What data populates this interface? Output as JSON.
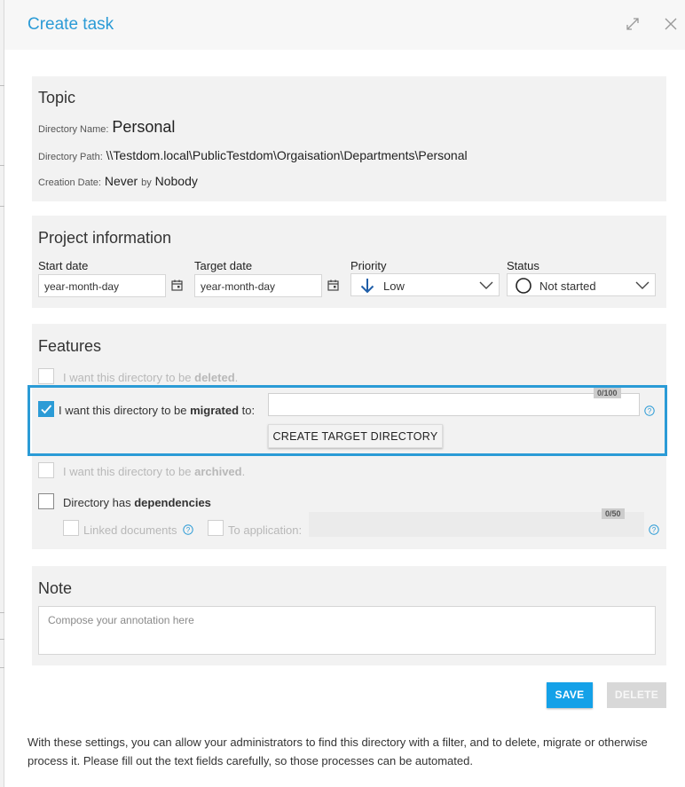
{
  "dialog": {
    "title": "Create task"
  },
  "topic": {
    "heading": "Topic",
    "directory_name_label": "Directory Name:",
    "directory_name": "Personal",
    "directory_path_label": "Directory Path:",
    "directory_path": "\\\\Testdom.local\\PublicTestdom\\Orgaisation\\Departments\\Personal",
    "creation_date_label": "Creation Date:",
    "creation_date": "Never",
    "by_label": "by",
    "creator": "Nobody"
  },
  "project": {
    "heading": "Project information",
    "start_date_label": "Start date",
    "start_date_value": "year-month-day",
    "target_date_label": "Target date",
    "target_date_value": "year-month-day",
    "priority_label": "Priority",
    "priority_value": "Low",
    "status_label": "Status",
    "status_value": "Not started"
  },
  "features": {
    "heading": "Features",
    "deleted_prefix": "I want this directory to be ",
    "deleted_bold": "deleted",
    "deleted_suffix": ".",
    "migrated_prefix": "I want this directory to be ",
    "migrated_bold": "migrated",
    "migrated_suffix": " to:",
    "migrated_checked": true,
    "migrated_counter": "0/100",
    "create_target_button": "CREATE TARGET DIRECTORY",
    "archived_prefix": "I want this directory to be ",
    "archived_bold": "archived",
    "archived_suffix": ".",
    "dependencies_prefix": "Directory has ",
    "dependencies_bold": "dependencies",
    "linked_documents": "Linked documents",
    "to_application": "To application:",
    "application_counter": "0/50"
  },
  "note": {
    "heading": "Note",
    "placeholder": "Compose your annotation here"
  },
  "actions": {
    "save": "SAVE",
    "delete": "DELETE"
  },
  "footer": {
    "text": "With these settings, you can allow your administrators to find this directory with a filter, and to delete, migrate or otherwise process it. Please fill out the text fields carefully, so those processes can be automated."
  },
  "colors": {
    "accent": "#2b9bd6",
    "save_button": "#14a1e8",
    "panel_bg": "#f2f2f2"
  }
}
